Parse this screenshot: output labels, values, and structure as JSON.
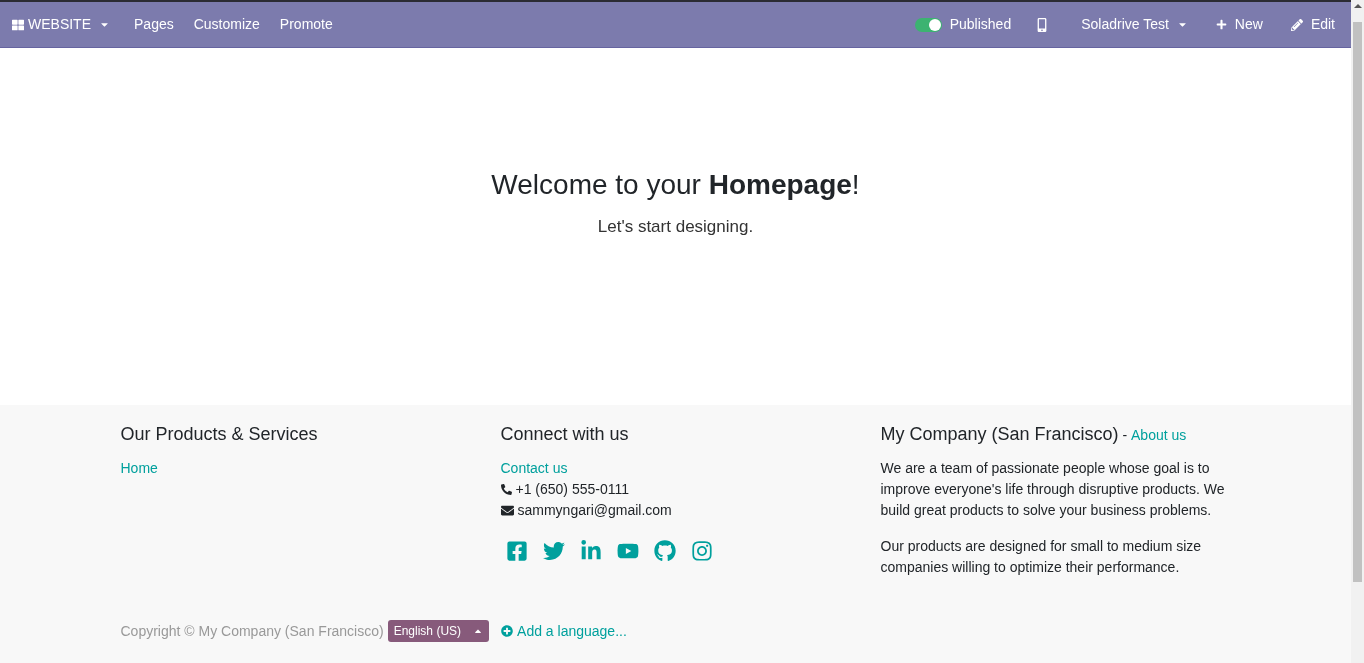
{
  "topbar": {
    "app_menu": "WEBSITE",
    "menu": [
      "Pages",
      "Customize",
      "Promote"
    ],
    "published": {
      "label": "Published",
      "on": true
    },
    "website_menu": "Soladrive Test",
    "new_button": "New",
    "edit_button": "Edit"
  },
  "hero": {
    "title": "Welcome to your **Homepage**!",
    "subtitle": "Let's start designing."
  },
  "footer": {
    "columns": [
      {
        "title": "Our Products & Services",
        "links": [
          "Home"
        ]
      },
      {
        "title": "Connect with us",
        "links": [
          "Contact us"
        ],
        "phone": "+1 (650) 555-0111",
        "email": "sammyngari@gmail.com",
        "social": [
          {
            "kind": "facebook"
          },
          {
            "kind": "twitter"
          },
          {
            "kind": "linkedin"
          },
          {
            "kind": "youtube"
          },
          {
            "kind": "github"
          },
          {
            "kind": "instagram"
          }
        ]
      },
      {
        "title": "My Company (San Francisco)",
        "separator": " - ",
        "title_link": "About us",
        "paragraphs": [
          "We are a team of passionate people whose goal is to improve everyone's life through disruptive products. We build great products to solve your business problems.",
          "Our products are designed for small to medium size companies willing to optimize their performance."
        ]
      }
    ],
    "copyright": "Copyright © My Company (San Francisco)",
    "language": "English (US)",
    "add_language": "Add a language..."
  }
}
